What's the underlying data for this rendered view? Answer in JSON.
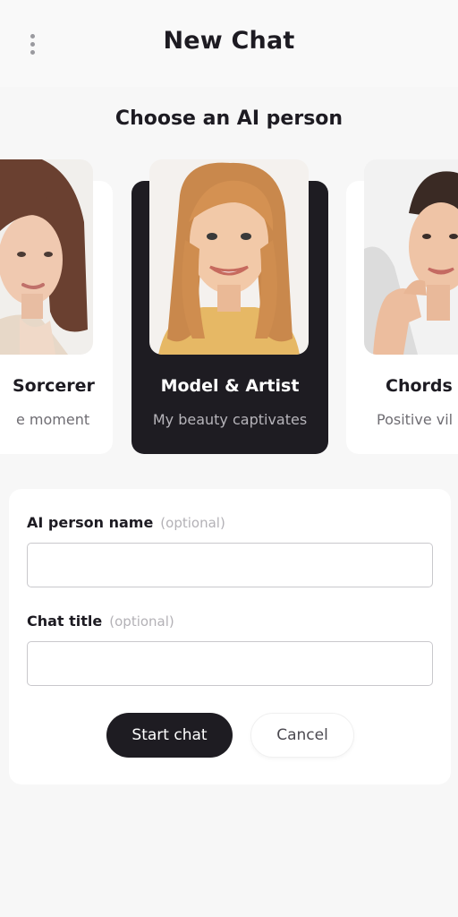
{
  "header": {
    "title": "New Chat",
    "menu_icon": "more-vertical-icon"
  },
  "persona_section": {
    "title": "Choose an AI person",
    "personas": [
      {
        "name": "Sorcerer",
        "description": "e moment",
        "selected": false,
        "photo": "portrait-brunette-woman"
      },
      {
        "name": "Model & Artist",
        "description": "My beauty captivates",
        "selected": true,
        "photo": "portrait-blonde-woman-smiling"
      },
      {
        "name": "Chords",
        "description": "Positive vil",
        "selected": false,
        "photo": "portrait-dark-haired-woman-smiling"
      }
    ]
  },
  "form": {
    "name_label": "AI person name",
    "name_optional": "(optional)",
    "name_value": "",
    "title_label": "Chat title",
    "title_optional": "(optional)",
    "title_value": "",
    "start_label": "Start chat",
    "cancel_label": "Cancel"
  },
  "colors": {
    "accent": "#1e1c22",
    "background": "#f7f7f7",
    "card": "#ffffff",
    "muted_text": "#b3b1b6"
  }
}
